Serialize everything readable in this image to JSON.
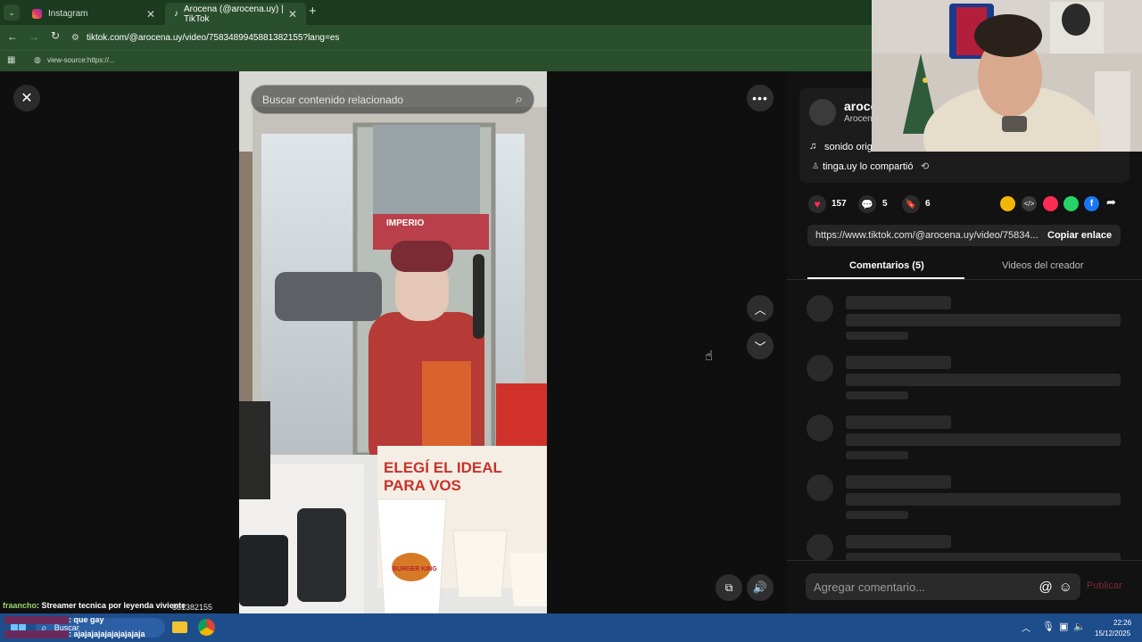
{
  "browser": {
    "tabs": [
      {
        "label": "Instagram",
        "icon": "instagram-icon"
      },
      {
        "label": "Arocena (@arocena.uy) | TikTok",
        "icon": "tiktok-icon"
      }
    ],
    "url": "tiktok.com/@arocena.uy/video/7583489945881382155?lang=es",
    "bookmark": "view-source:https://..."
  },
  "video": {
    "search_placeholder": "Buscar contenido relacionado",
    "sign_text_1": "ELEGÍ EL IDEAL",
    "sign_text_2": "PARA VOS",
    "cup_brand": "BURGER KING",
    "storefront": "IMPERIO"
  },
  "creator": {
    "name": "aroce",
    "handle": "Arocen",
    "sound": "sonido orig",
    "shared_by": "tinga.uy lo compartió"
  },
  "stats": {
    "likes": "157",
    "comments": "5",
    "saves": "6"
  },
  "share": {
    "link": "https://www.tiktok.com/@arocena.uy/video/75834...",
    "copy_label": "Copiar enlace"
  },
  "tabs": {
    "comments": "Comentarios (5)",
    "creator_videos": "Videos del creador"
  },
  "comment_box": {
    "placeholder": "Agregar comentario...",
    "publish": "Publicar"
  },
  "chat": [
    {
      "user": "fraancho",
      "text": ": Streamer tecnica por leyenda viviente"
    },
    {
      "user": "",
      "text": ": que gay"
    },
    {
      "user": "",
      "text": ": ajajajajajajajajajaja"
    }
  ],
  "chat_overlay_url": "881382155",
  "taskbar": {
    "search": "Buscar",
    "time": "22:26",
    "date": "15/12/2025"
  },
  "colors": {
    "accent_pink": "#fe2c55",
    "chrome_green": "#2a4f2c",
    "taskbar_blue": "#1e4d8c"
  }
}
